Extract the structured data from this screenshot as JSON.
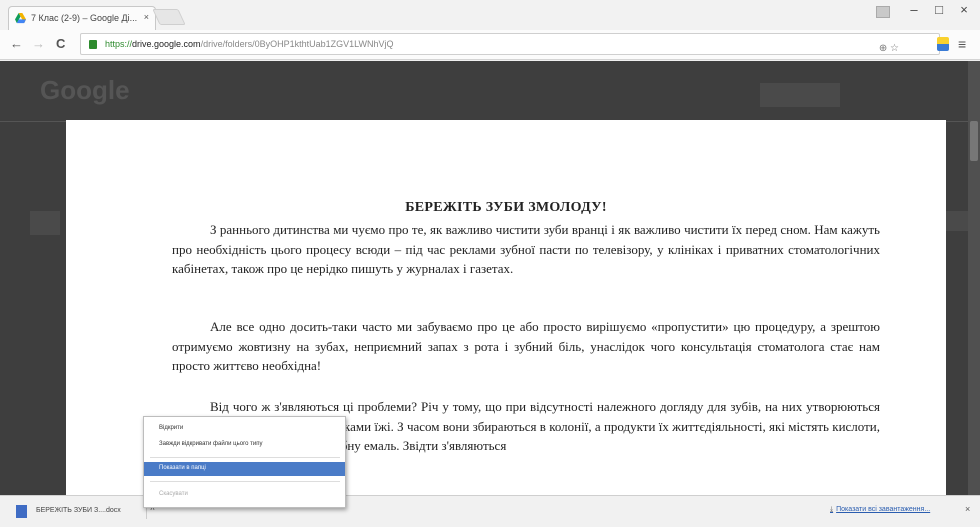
{
  "browser": {
    "tab_title": "7 Клас (2-9) – Google Ді...",
    "tab_close": "×",
    "win_minimize": "–",
    "win_maximize": "□",
    "win_close": "×",
    "nav_back": "←",
    "nav_forward": "→",
    "nav_reload": "C",
    "url_scheme": "https://",
    "url_host": "drive.google.com",
    "url_path": "/drive/folders/0ByOHP1kthtUab1ZGV1LWNhVjQ",
    "omni_icons": "⊕ ☆",
    "menu_icon": "≡"
  },
  "background": {
    "logo": "Google"
  },
  "document": {
    "title": "БЕРЕЖІТЬ ЗУБИ ЗМОЛОДУ!",
    "paragraphs": [
      "З раннього дитинства ми чуємо про те, як важливо чистити зуби вранці і як важливо чистити їх перед сном. Нам кажуть про необхідність цього процесу всюди – під час реклами зубної пасти по телевізору, у клініках і приватних стоматологічних кабінетах, також про це нерідко пишуть у журналах і газетах.",
      "Але все одно досить-таки часто ми забуваємо про це або просто вирішуємо «пропустити» цю процедуру, а зрештою отримуємо жовтизну на зубах, неприємний запах з рота і зубний біль, унаслідок чого консультація стоматолога стає нам просто життєво необхідна!",
      "Від чого ж з'являються ці проблеми? Річ у тому, що при відсутності належного догляду для зубів, на них утворюються бактерії, що харчуються залишками їжі. З часом вони збираються в колонії, а продукти їх життєдіяльності, які містять кислоти, що руйнують, у свою чергу, зубну емаль. Звідти з'являються"
    ]
  },
  "context_menu": {
    "items": [
      {
        "label": "Відкрити",
        "state": "normal"
      },
      {
        "label": "Завжди відкривати файли цього типу",
        "state": "normal"
      },
      {
        "label": "Показати в папці",
        "state": "highlighted"
      },
      {
        "label": "Скасувати",
        "state": "disabled"
      }
    ]
  },
  "download_bar": {
    "file_name": "БЕРЕЖІТЬ ЗУБИ З....docx",
    "arrow": "˄",
    "show_all": "Показати всі завантаження...",
    "download_icon": "⤓",
    "close": "×"
  }
}
